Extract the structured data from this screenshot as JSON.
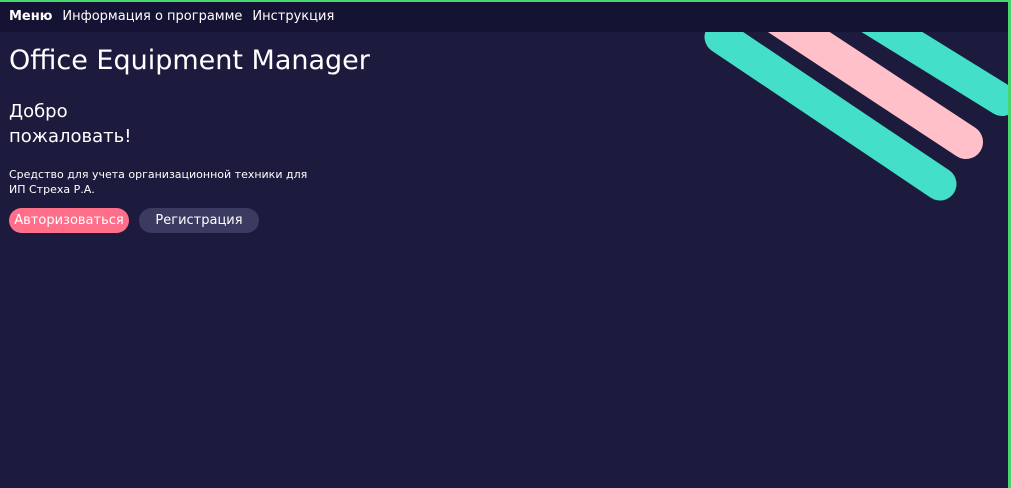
{
  "menu": {
    "items": [
      {
        "label": "Меню"
      },
      {
        "label": "Информация о программе"
      },
      {
        "label": "Инструкция"
      }
    ]
  },
  "main": {
    "app_title": "Office Equipment Manager",
    "welcome_line_1": "Добро",
    "welcome_line_2": "пожаловать!",
    "description_line_1": "Средство для учета организационной техники для",
    "description_line_2": "ИП Стреха Р.А.",
    "buttons": {
      "login": "Авторизоваться",
      "register": "Регистрация"
    }
  },
  "colors": {
    "background": "#1d1b3d",
    "topbar": "#151334",
    "accent_teal": "#43dfc8",
    "accent_pink": "#ffc0ca",
    "button_primary": "#ff6f8a",
    "button_secondary": "#3b3a61",
    "frame_green": "#49d66f"
  },
  "icons": {
    "decorative_stripes": "diagonal-stripes-graphic"
  }
}
